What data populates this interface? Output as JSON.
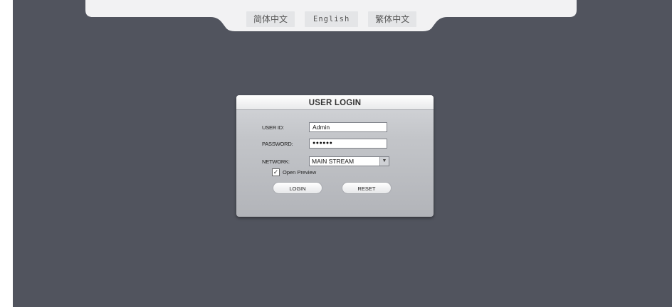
{
  "languages": {
    "simplified_chinese": "简体中文",
    "english": "English",
    "traditional_chinese": "繁体中文"
  },
  "login": {
    "title": "USER LOGIN",
    "user_id_label": "USER ID:",
    "user_id_value": "Admin",
    "password_label": "PASSWORD:",
    "password_value": "●●●●●●",
    "network_label": "NETWORK:",
    "network_value": "MAIN STREAM",
    "open_preview_label": "Open Preview",
    "open_preview_checked": true,
    "login_button": "LOGIN",
    "reset_button": "RESET"
  },
  "colors": {
    "background": "#51545e",
    "panel": "#c3c5c9"
  }
}
